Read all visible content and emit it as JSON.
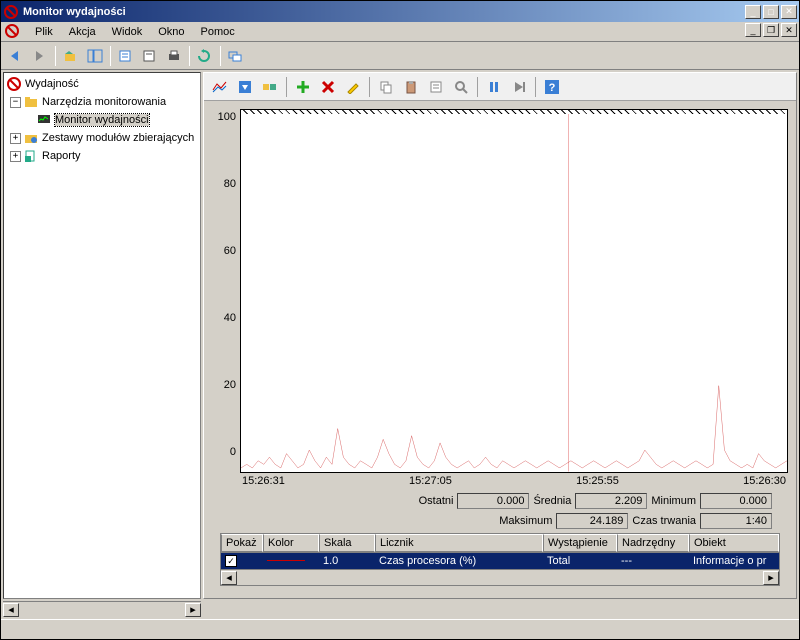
{
  "window": {
    "title": "Monitor wydajności"
  },
  "menu": {
    "file": "Plik",
    "action": "Akcja",
    "view": "Widok",
    "window": "Okno",
    "help": "Pomoc"
  },
  "tree": {
    "root": "Wydajność",
    "monitoring_tools": "Narzędzia monitorowania",
    "perf_monitor": "Monitor wydajności",
    "collector_sets": "Zestawy modułów zbierających",
    "reports": "Raporty"
  },
  "chart_data": {
    "type": "line",
    "title": "",
    "ylim": [
      0,
      100
    ],
    "yticks": [
      100,
      80,
      60,
      40,
      20,
      0
    ],
    "xticks": [
      "15:26:31",
      "15:27:05",
      "15:25:55",
      "15:26:30"
    ],
    "cursor_x_frac": 0.6,
    "series": [
      {
        "name": "Czas procesora (%)",
        "color": "#c00000",
        "values": [
          1,
          2,
          1,
          3,
          2,
          4,
          2,
          1,
          5,
          3,
          1,
          2,
          6,
          3,
          1,
          4,
          2,
          12,
          4,
          2,
          1,
          3,
          2,
          1,
          4,
          9,
          5,
          2,
          1,
          3,
          10,
          4,
          2,
          1,
          3,
          8,
          4,
          2,
          1,
          2,
          3,
          1,
          2,
          4,
          2,
          1,
          3,
          2,
          1,
          2,
          3,
          2,
          1,
          2,
          3,
          2,
          1,
          2,
          3,
          2,
          1,
          2,
          3,
          2,
          1,
          2,
          3,
          2,
          1,
          2,
          3,
          6,
          4,
          2,
          1,
          2,
          3,
          2,
          1,
          2,
          3,
          2,
          1,
          2,
          24,
          6,
          3,
          2,
          1,
          2,
          1,
          5,
          3,
          2,
          1,
          2,
          3
        ]
      }
    ]
  },
  "stats": {
    "last_label": "Ostatni",
    "last_val": "0.000",
    "avg_label": "Średnia",
    "avg_val": "2.209",
    "min_label": "Minimum",
    "min_val": "0.000",
    "max_label": "Maksimum",
    "max_val": "24.189",
    "dur_label": "Czas trwania",
    "dur_val": "1:40"
  },
  "grid": {
    "headers": {
      "show": "Pokaż",
      "color": "Kolor",
      "scale": "Skala",
      "counter": "Licznik",
      "instance": "Wystąpienie",
      "parent": "Nadrzędny",
      "object": "Obiekt"
    },
    "row": {
      "show": "✓",
      "scale": "1.0",
      "counter": "Czas procesora (%)",
      "instance": "Total",
      "parent": "---",
      "object": "Informacje o pr"
    }
  }
}
